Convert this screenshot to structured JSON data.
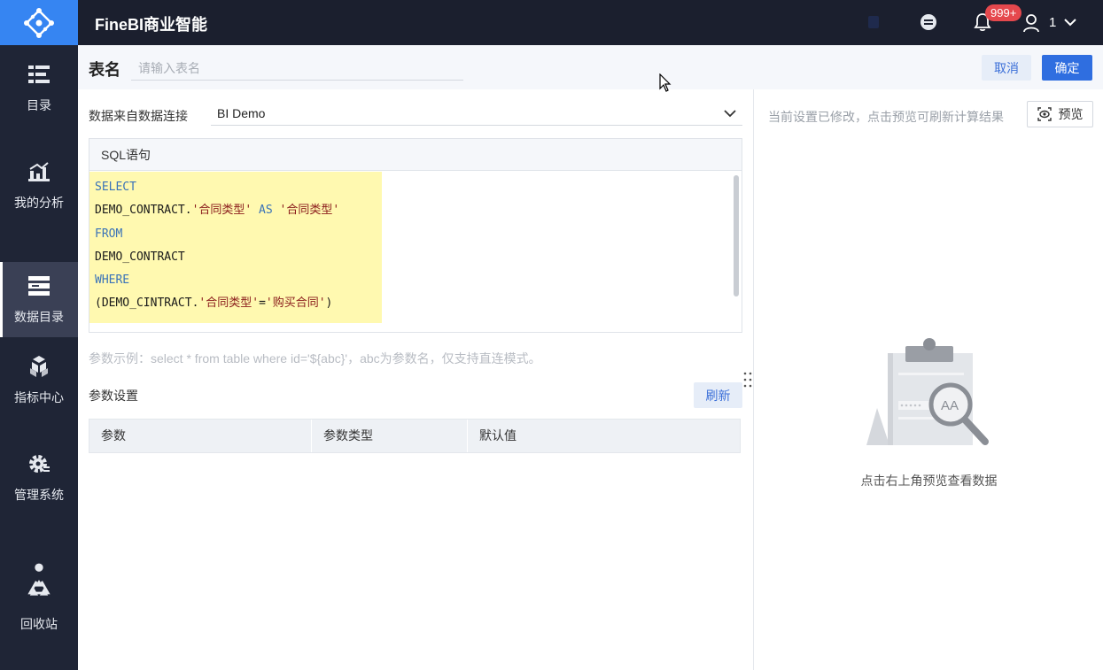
{
  "header": {
    "title": "FineBI商业智能",
    "notification_badge": "999+",
    "user_name": "1"
  },
  "sidebar": {
    "items": [
      {
        "label": "目录",
        "icon": "catalog-icon"
      },
      {
        "label": "我的分析",
        "icon": "analysis-icon"
      },
      {
        "label": "数据目录",
        "icon": "data-catalog-icon",
        "active": true
      },
      {
        "label": "指标中心",
        "icon": "metrics-icon"
      },
      {
        "label": "管理系统",
        "icon": "settings-gear-icon"
      },
      {
        "label": "回收站",
        "icon": "recycle-icon"
      }
    ]
  },
  "titlebar": {
    "label": "表名",
    "input_placeholder": "请输入表名",
    "cancel_label": "取消",
    "confirm_label": "确定"
  },
  "datasource": {
    "label": "数据来自数据连接",
    "value": "BI Demo"
  },
  "sql": {
    "header": "SQL语句",
    "lines": {
      "l1_kw": "SELECT",
      "l2_pre": "DEMO_CONTRACT.",
      "l2_str1": "'合同类型'",
      "l2_kw": " AS ",
      "l2_str2": "'合同类型'",
      "l3_kw": "FROM",
      "l4": "DEMO_CONTRACT",
      "l5_kw": "WHERE",
      "l6_pre": "(DEMO_CINTRACT.",
      "l6_str1": "'合同类型'",
      "l6_eq": "=",
      "l6_str2": "'购买合同'",
      "l6_post": ")"
    }
  },
  "params": {
    "hint": "参数示例：select * from table where id='${abc}'，abc为参数名，仅支持直连模式。",
    "title": "参数设置",
    "refresh_label": "刷新",
    "columns": [
      "参数",
      "参数类型",
      "默认值"
    ]
  },
  "preview": {
    "message": "当前设置已修改，点击预览可刷新计算结果",
    "button_label": "预览",
    "empty_text": "点击右上角预览查看数据",
    "illustration_text": "AA"
  },
  "colors": {
    "sidebar_bg": "#1f2536",
    "header_bg": "#1b1f2e",
    "logo_bg": "#3685f2",
    "primary": "#2f6ee0",
    "badge": "#e5484d",
    "code_highlight": "#fff9b0"
  }
}
